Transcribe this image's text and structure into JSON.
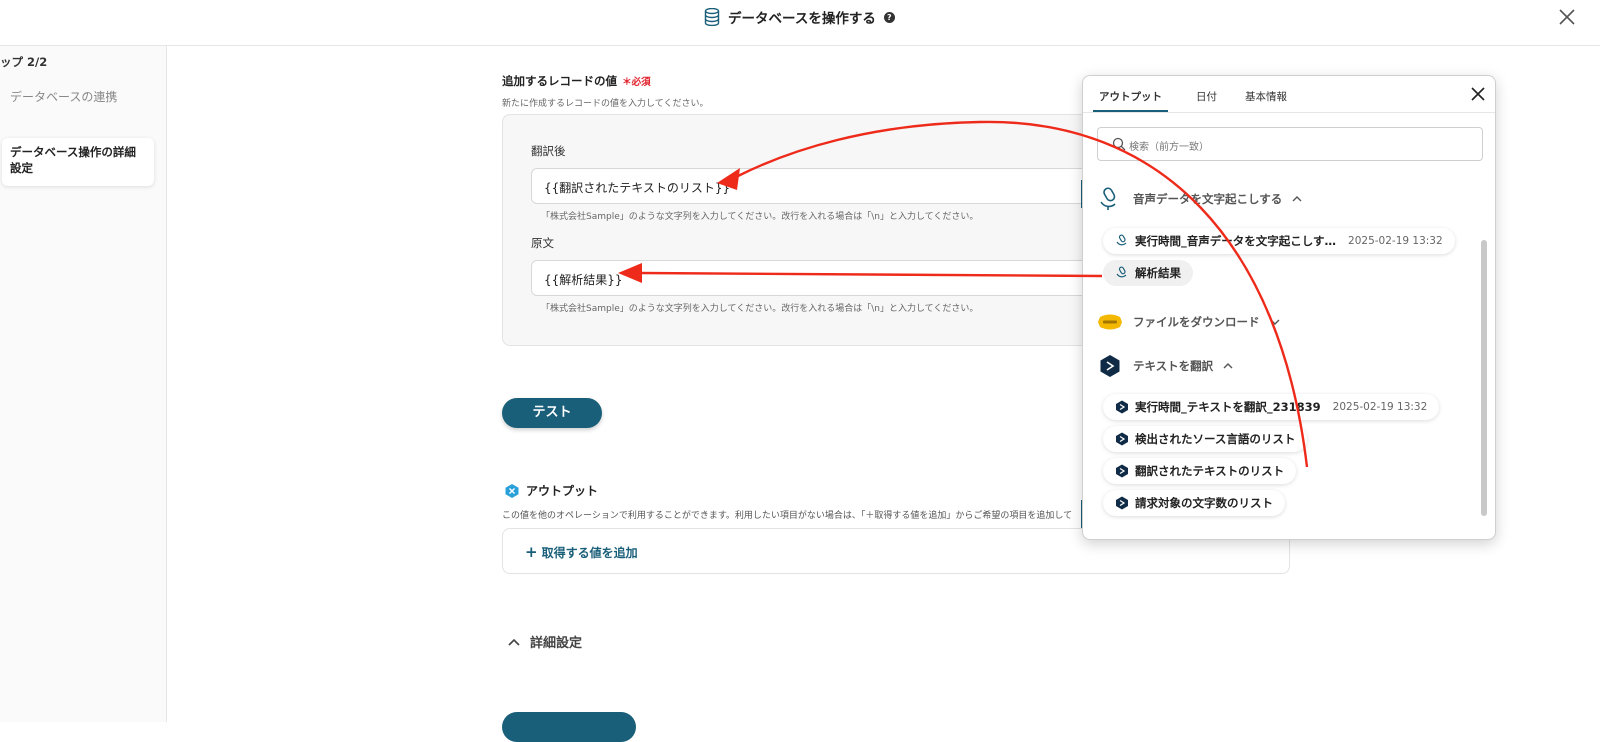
{
  "header": {
    "title": "データベースを操作する",
    "help_icon": "question-icon",
    "close_icon": "close-icon"
  },
  "sidebar": {
    "step": "ップ 2/2",
    "items": [
      {
        "label": "データベースの連携"
      },
      {
        "label": "データベース操作の詳細設定"
      }
    ]
  },
  "form": {
    "section_label": "追加するレコードの値",
    "required": "＊必須",
    "section_hint": "新たに作成するレコードの値を入力してください。",
    "fields": [
      {
        "label": "翻訳後",
        "value": "{{翻訳されたテキストのリスト}}",
        "hint": "「株式会社Sample」のような文字列を入力してください。改行を入れる場合は「\\n」と入力してください。"
      },
      {
        "label": "原文",
        "value": "{{解析結果}}",
        "hint": "「株式会社Sample」のような文字列を入力してください。改行を入れる場合は「\\n」と入力してください。"
      }
    ],
    "test_button": "テスト"
  },
  "output": {
    "title": "アウトプット",
    "hint": "この値を他のオペレーションで利用することができます。利用したい項目がない場合は、「＋取得する値を追加」からご希望の項目を追加して",
    "add_link": "取得する値を追加"
  },
  "details": {
    "label": "詳細設定"
  },
  "panel": {
    "tabs": [
      {
        "label": "アウトプット"
      },
      {
        "label": "日付"
      },
      {
        "label": "基本情報"
      }
    ],
    "search_placeholder": "検索（前方一致）",
    "groups": [
      {
        "title": "音声データを文字起こしする",
        "icon": "microphone-icon",
        "expanded": true,
        "items": [
          {
            "label": "実行時間_音声データを文字起こしす…",
            "timestamp": "2025-02-19 13:32"
          },
          {
            "label": "解析結果"
          }
        ]
      },
      {
        "title": "ファイルをダウンロード",
        "icon": "kintone-icon",
        "expanded": false
      },
      {
        "title": "テキストを翻訳",
        "icon": "deepl-icon",
        "expanded": true,
        "items": [
          {
            "label": "実行時間_テキストを翻訳_231839",
            "timestamp": "2025-02-19 13:32"
          },
          {
            "label": "検出されたソース言語のリスト"
          },
          {
            "label": "翻訳されたテキストのリスト"
          },
          {
            "label": "請求対象の文字数のリスト"
          }
        ]
      }
    ]
  },
  "colors": {
    "accent": "#1a5f7a",
    "required": "#e0242e",
    "annotation_arrow": "#ee2a1a",
    "kintone": "#f5b800"
  }
}
